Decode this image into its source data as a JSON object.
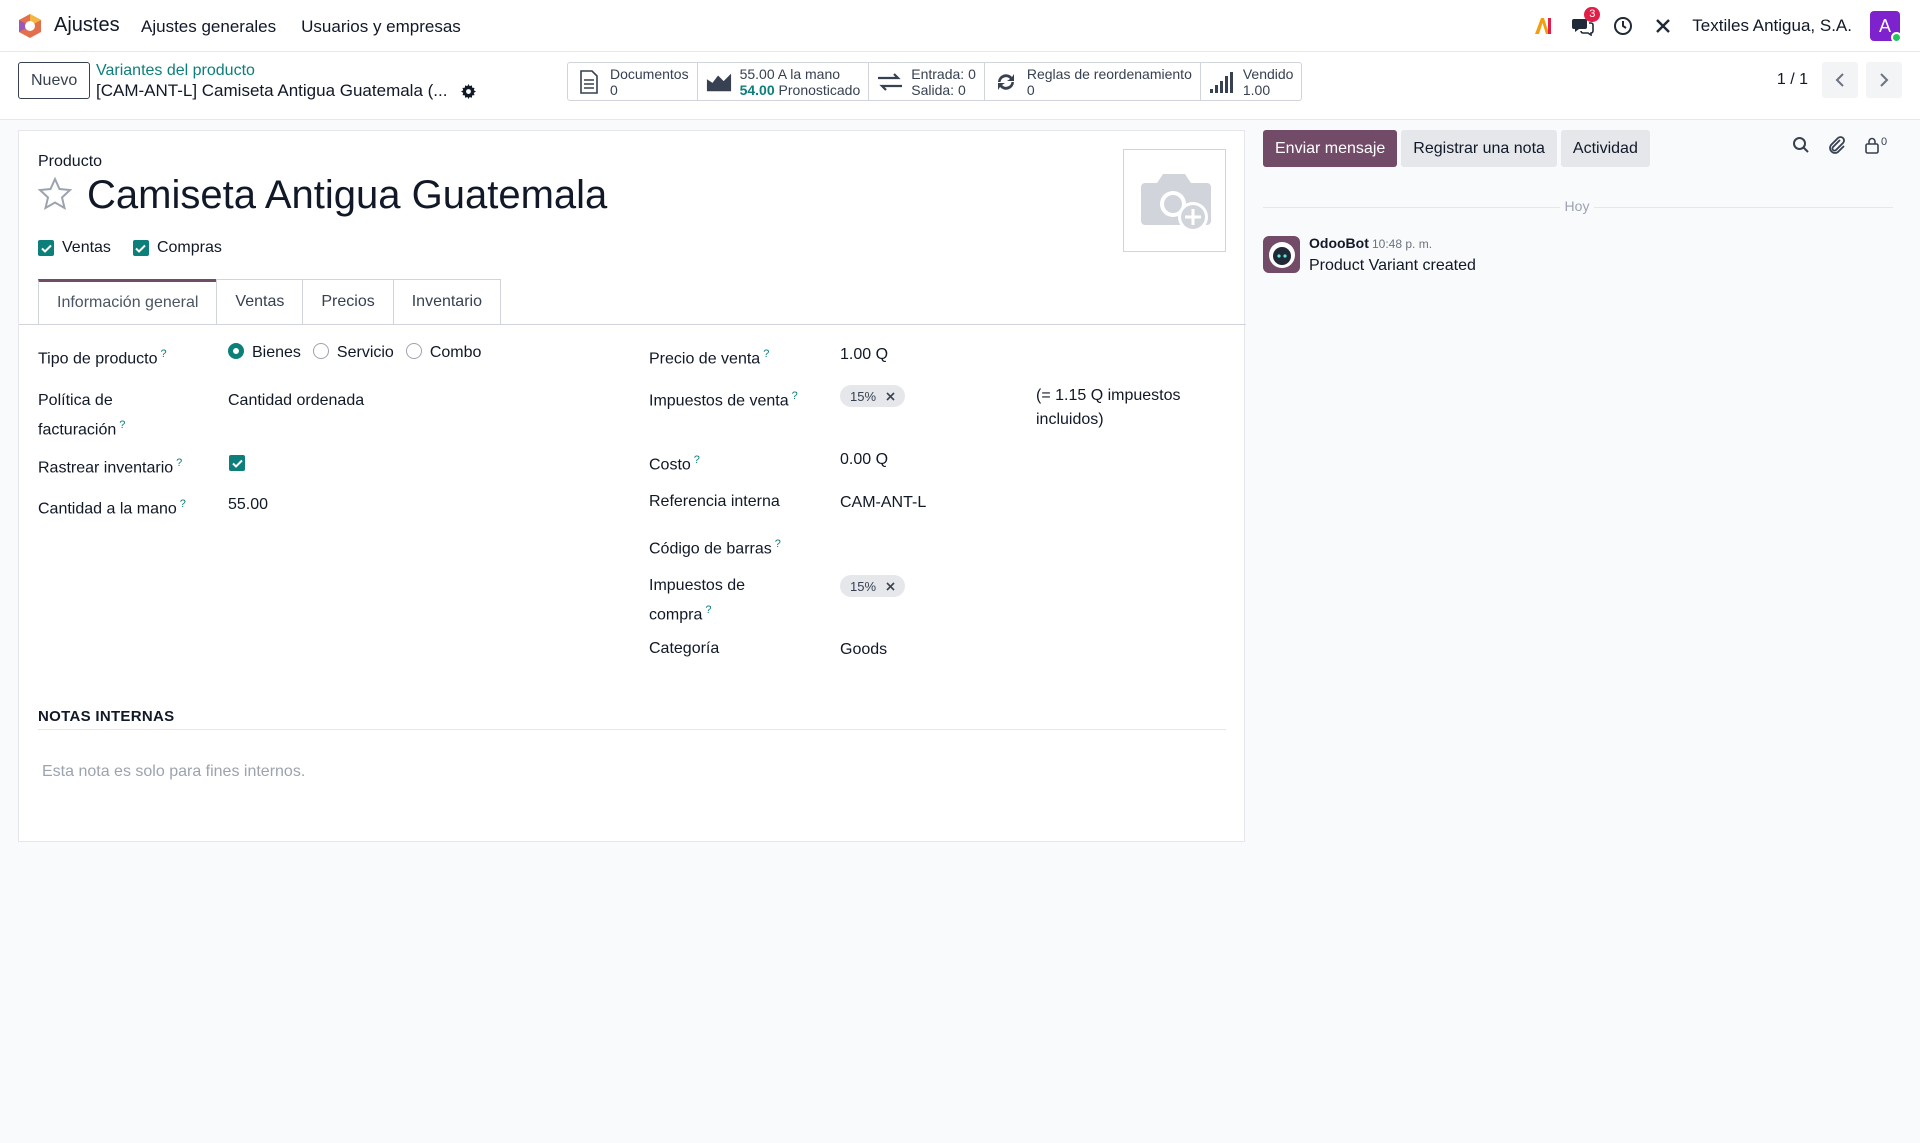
{
  "navbar": {
    "app_name": "Ajustes",
    "menu": [
      "Ajustes generales",
      "Usuarios y empresas"
    ],
    "messages_badge": "3",
    "company": "Textiles Antigua, S.A.",
    "avatar_letter": "A"
  },
  "control": {
    "new_label": "Nuevo",
    "breadcrumb": "Variantes del producto",
    "record_title": "[CAM-ANT-L] Camiseta Antigua Guatemala (...",
    "stats": {
      "documents_label": "Documentos",
      "documents_value": "0",
      "onhand_value": "55.00",
      "onhand_label": "A la mano",
      "forecast_value": "54.00",
      "forecast_label": "Pronosticado",
      "in_label": "Entrada: 0",
      "out_label": "Salida: 0",
      "reorder_label": "Reglas de reordenamiento",
      "reorder_value": "0",
      "sold_label": "Vendido",
      "sold_value": "1.00"
    },
    "pager": "1 / 1"
  },
  "form": {
    "product_label": "Producto",
    "product_name": "Camiseta Antigua Guatemala",
    "sales_check": "Ventas",
    "purchase_check": "Compras",
    "tabs": [
      "Información general",
      "Ventas",
      "Precios",
      "Inventario"
    ],
    "left": {
      "product_type_label": "Tipo de producto",
      "type_options": [
        "Bienes",
        "Servicio",
        "Combo"
      ],
      "invoice_policy_label_1": "Política de",
      "invoice_policy_label_2": "facturación",
      "invoice_policy_value": "Cantidad ordenada",
      "track_inventory_label": "Rastrear inventario",
      "qty_on_hand_label": "Cantidad a la mano",
      "qty_on_hand_value": "55.00"
    },
    "right": {
      "sale_price_label": "Precio de venta",
      "sale_price_value": "1.00 Q",
      "sale_taxes_label": "Impuestos de venta",
      "sale_tax_tag": "15%",
      "tax_included_1": "(= 1.15 Q impuestos",
      "tax_included_2": "incluidos)",
      "cost_label": "Costo",
      "cost_value": "0.00 Q",
      "internal_ref_label": "Referencia interna",
      "internal_ref_value": "CAM-ANT-L",
      "barcode_label": "Código de barras",
      "purchase_taxes_label_1": "Impuestos de",
      "purchase_taxes_label_2": "compra",
      "purchase_tax_tag": "15%",
      "category_label": "Categoría",
      "category_value": "Goods"
    },
    "notes_title": "NOTAS INTERNAS",
    "notes_placeholder": "Esta nota es solo para fines internos."
  },
  "chatter": {
    "send_message": "Enviar mensaje",
    "log_note": "Registrar una nota",
    "activity": "Actividad",
    "followers_count": "0",
    "today": "Hoy",
    "message": {
      "author": "OdooBot",
      "time": "10:48 p. m.",
      "body": "Product Variant created"
    }
  },
  "colors": {
    "brand": "#714b67",
    "accent": "#0d7f7a"
  }
}
